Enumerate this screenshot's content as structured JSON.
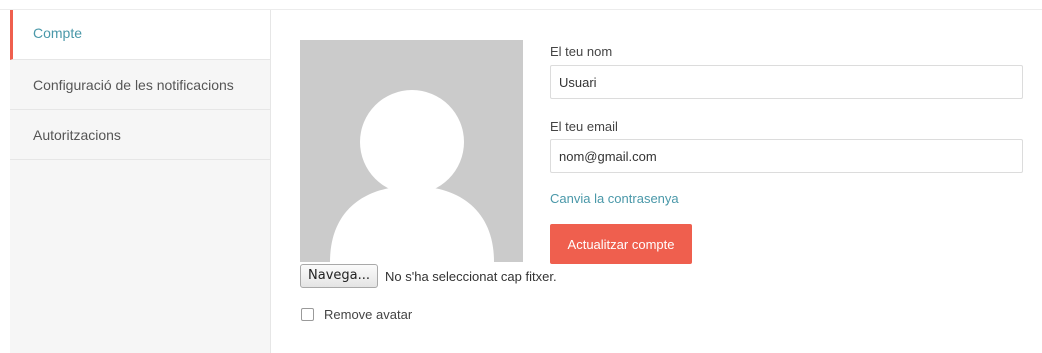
{
  "sidebar": {
    "items": [
      {
        "label": "Compte",
        "active": true
      },
      {
        "label": "Configuració de les notificacions",
        "active": false
      },
      {
        "label": "Autoritzacions",
        "active": false
      }
    ]
  },
  "avatar": {
    "icon": "default-user-silhouette",
    "background_color": "#cbcbcb"
  },
  "file_input": {
    "browse_label": "Navega...",
    "status_text": "No s'ha seleccionat cap fitxer."
  },
  "remove_avatar": {
    "label": "Remove avatar",
    "checked": false
  },
  "form": {
    "name_label": "El teu nom",
    "name_value": "Usuari",
    "email_label": "El teu email",
    "email_value": "nom@gmail.com",
    "change_password_link": "Canvia la contrasenya",
    "update_button": "Actualitzar compte"
  },
  "colors": {
    "accent": "#ef5f4e",
    "link": "#4a98a9"
  }
}
